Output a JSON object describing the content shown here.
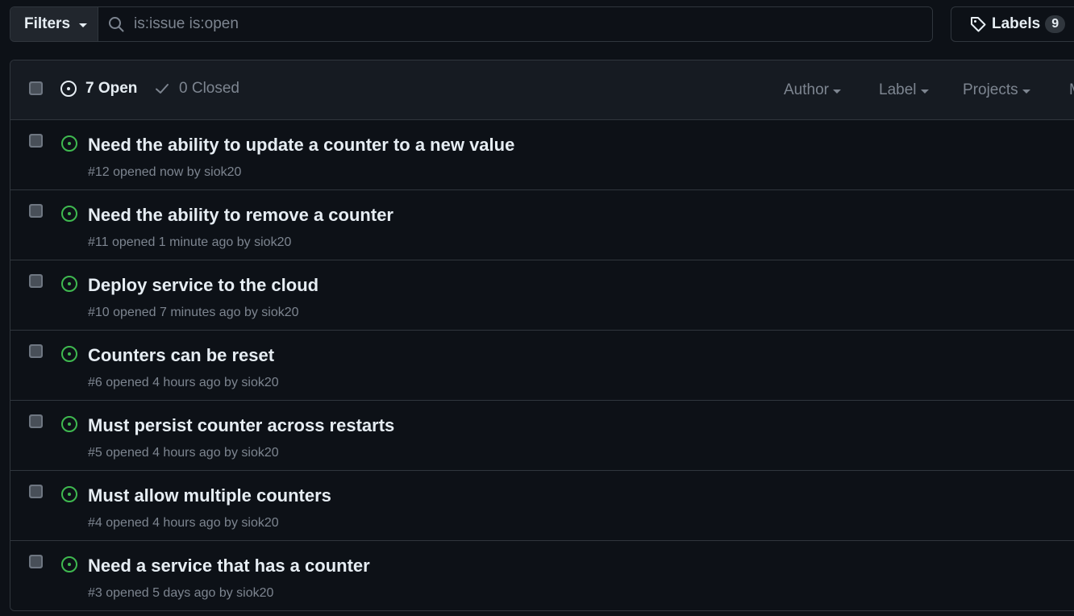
{
  "toolbar": {
    "filters_label": "Filters",
    "search_value": "is:issue is:open",
    "labels_label": "Labels",
    "labels_count": "9"
  },
  "header": {
    "open_label": "7 Open",
    "closed_label": "0 Closed",
    "author_label": "Author",
    "label_label": "Label",
    "projects_label": "Projects",
    "milestones_label": "M"
  },
  "colors": {
    "background": "#0d1117",
    "open_icon": "#3fb950",
    "border": "#30363d",
    "muted_text": "#7d8590"
  },
  "issues": [
    {
      "title": "Need the ability to update a counter to a new value",
      "number": "#12",
      "opened": "opened now by",
      "author": "siok20"
    },
    {
      "title": "Need the ability to remove a counter",
      "number": "#11",
      "opened": "opened 1 minute ago by",
      "author": "siok20"
    },
    {
      "title": "Deploy service to the cloud",
      "number": "#10",
      "opened": "opened 7 minutes ago by",
      "author": "siok20"
    },
    {
      "title": "Counters can be reset",
      "number": "#6",
      "opened": "opened 4 hours ago by",
      "author": "siok20"
    },
    {
      "title": "Must persist counter across restarts",
      "number": "#5",
      "opened": "opened 4 hours ago by",
      "author": "siok20"
    },
    {
      "title": "Must allow multiple counters",
      "number": "#4",
      "opened": "opened 4 hours ago by",
      "author": "siok20"
    },
    {
      "title": "Need a service that has a counter",
      "number": "#3",
      "opened": "opened 5 days ago by",
      "author": "siok20"
    }
  ]
}
